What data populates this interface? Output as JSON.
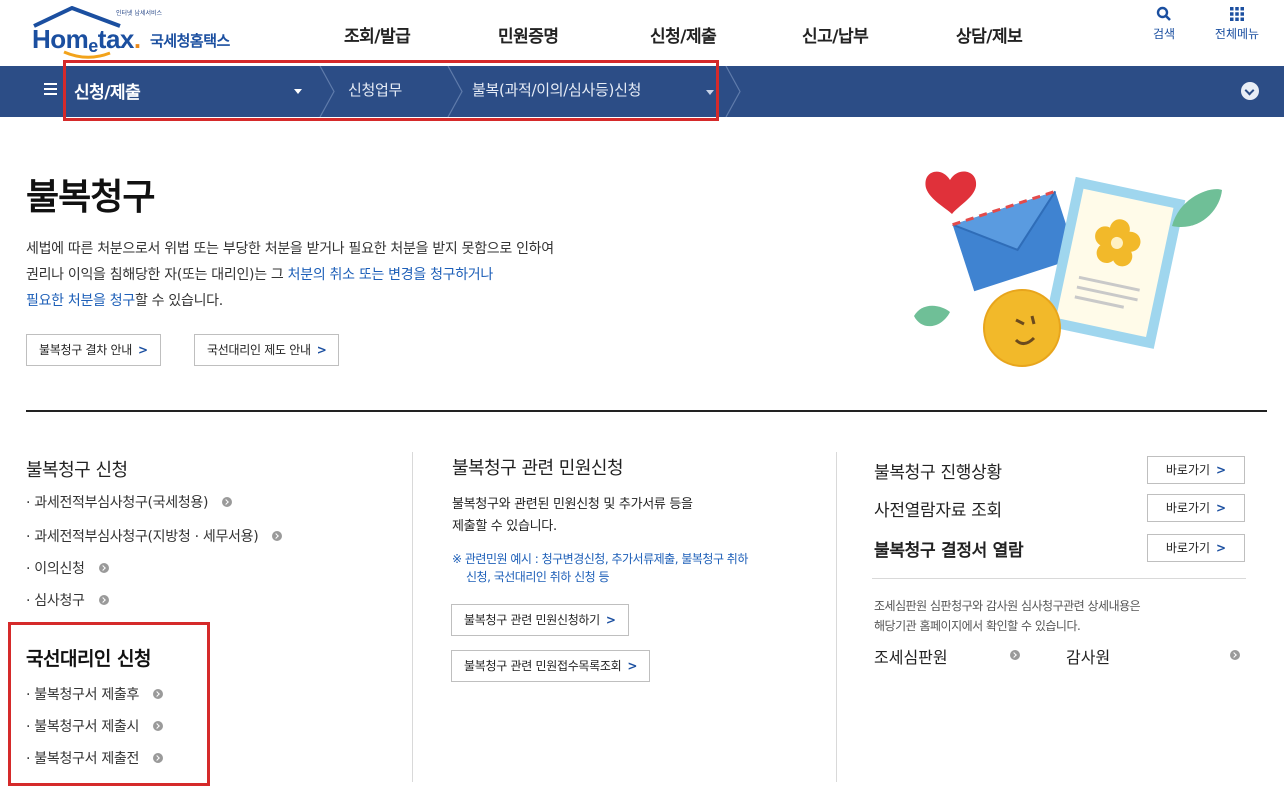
{
  "header": {
    "logo_tagline": "인터넷 납세서비스",
    "logo_brand_pre": "Hom",
    "logo_brand_e": "e",
    "logo_brand_post": "tax",
    "logo_brand_dot": ".",
    "logo_ko": "국세청홈택스",
    "nav": [
      "조회/발급",
      "민원증명",
      "신청/제출",
      "신고/납부",
      "상담/제보"
    ],
    "search_label": "검색",
    "allmenu_label": "전체메뉴"
  },
  "location": {
    "selected": "신청/제출",
    "crumb1": "신청업무",
    "crumb2": "불복(과적/이의/심사등)신청"
  },
  "hero": {
    "title": "불복청구",
    "desc_line1": "세법에 따른 처분으로서 위법 또는 부당한 처분을 받거나 필요한 처분을 받지 못함으로 인하여",
    "desc_line2_pre": "권리나 이익을 침해당한 자(또는 대리인)는 그 ",
    "desc_line2_hl": "처분의 취소 또는 변경을 청구하거나",
    "desc_line3_hl": "필요한 처분을 청구",
    "desc_line3_post": "할 수 있습니다.",
    "btn_procedure": "불복청구 결차 안내",
    "btn_representative": "국선대리인 제도 안내"
  },
  "left": {
    "title": "불복청구 신청",
    "items": [
      "· 과세전적부심사청구(국세청용)",
      "· 과세전적부심사청구(지방청 · 세무서용)",
      "· 이의신청",
      "· 심사청구"
    ],
    "sub_title": "국선대리인 신청",
    "sub_items": [
      "· 불복청구서 제출후",
      "· 불복청구서 제출시",
      "· 불복청구서 제출전"
    ]
  },
  "middle": {
    "title": "불복청구 관련 민원신청",
    "desc_line1": "불복청구와 관련된 민원신청 및 추가서류 등을",
    "desc_line2": "제출할 수 있습니다.",
    "note_line1": "※ 관련민원 예시 : 청구변경신청, 추가서류제출, 불복청구 취하",
    "note_line2": "신청, 국선대리인 취하 신청 등",
    "btn_apply": "불복청구 관련 민원신청하기",
    "btn_list": "불복청구 관련 민원접수목록조회"
  },
  "right": {
    "row1": "불복청구 진행상황",
    "row2": "사전열람자료 조회",
    "row3": "불복청구 결정서 열람",
    "goto_label": "바로가기",
    "desc_line1": "조세심판원 심판청구와 감사원 심사청구관련 상세내용은",
    "desc_line2": "해당기관 홈페이지에서 확인할 수 있습니다.",
    "agency1": "조세심판원",
    "agency2": "감사원"
  },
  "colors": {
    "brand_blue": "#1b4fa0",
    "locbar": "#2c4d86",
    "highlight_red": "#d52a2a",
    "link_blue": "#1d5fb8"
  }
}
